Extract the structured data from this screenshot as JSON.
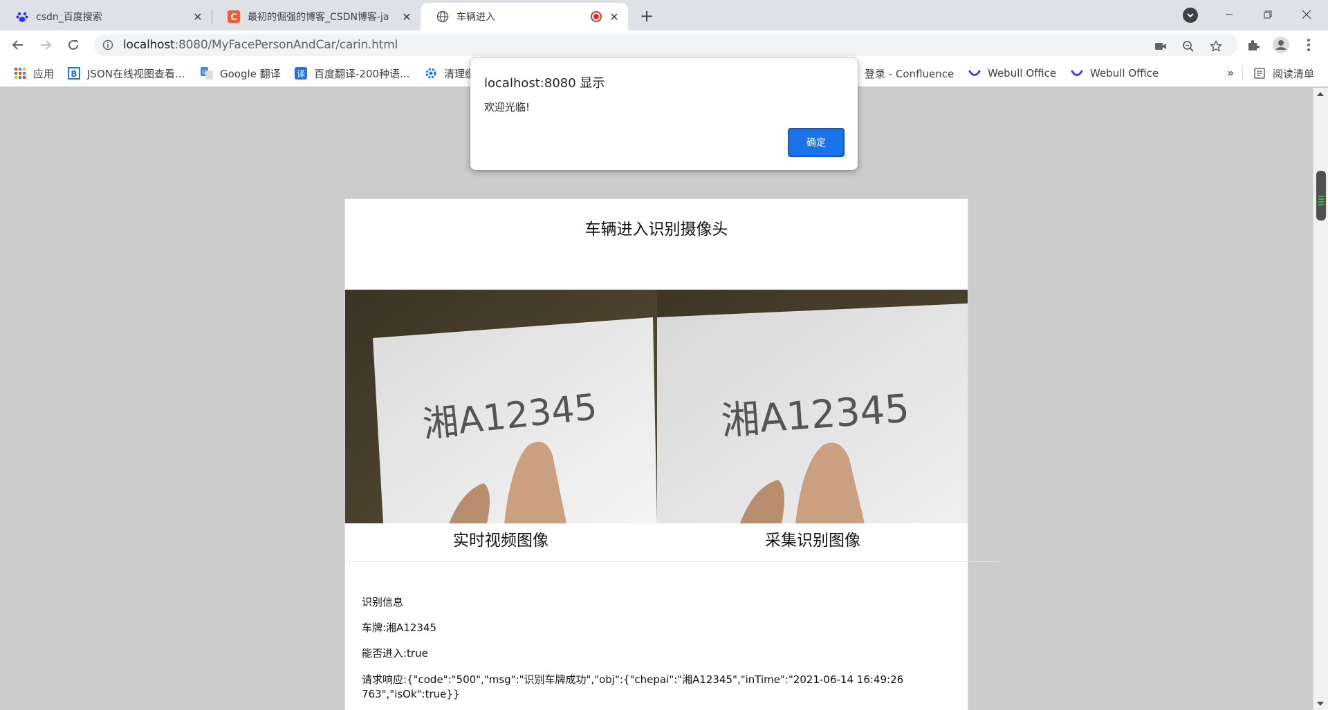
{
  "browser": {
    "tabs": [
      {
        "title": "csdn_百度搜索",
        "icon": "baidu-paw-icon"
      },
      {
        "title": "最初的倔强的博客_CSDN博客-ja",
        "icon": "csdn-icon"
      },
      {
        "title": "车辆进入",
        "icon": "globe-icon",
        "recording": true
      }
    ],
    "new_tab_label": "+",
    "url_host": "localhost",
    "url_path": ":8080/MyFacePersonAndCar/carin.html",
    "bookmarks": [
      {
        "label": "应用",
        "icon": "apps-grid-icon"
      },
      {
        "label": "JSON在线视图查看...",
        "icon": "b-icon"
      },
      {
        "label": "Google 翻译",
        "icon": "google-translate-icon"
      },
      {
        "label": "百度翻译-200种语...",
        "icon": "baidu-translate-icon"
      },
      {
        "label": "清理缓",
        "icon": "gear-icon"
      },
      {
        "label": "登录 - Confluence",
        "icon": "confluence-icon"
      },
      {
        "label": "Webull Office",
        "icon": "webull-icon"
      },
      {
        "label": "Webull Office",
        "icon": "webull-icon"
      }
    ],
    "bookmarks_more": "»",
    "reading_list": "阅读清单",
    "colors": {
      "accent": "#1a73e8",
      "tabstrip": "#dee1e6",
      "page_bg": "#cccccc",
      "record_red": "#d93025"
    }
  },
  "dialog": {
    "title": "localhost:8080 显示",
    "message": "欢迎光临!",
    "ok_label": "确定"
  },
  "page": {
    "heading": "车辆进入识别摄像头",
    "live_label": "实时视频图像",
    "capture_label": "采集识别图像",
    "photo_text": "湘A12345",
    "info_title": "识别信息",
    "plate_line": "车牌:湘A12345",
    "enter_line": "能否进入:true",
    "response_line1": "请求响应:{\"code\":\"500\",\"msg\":\"识别车牌成功\",\"obj\":{\"chepai\":\"湘A12345\",\"inTime\":\"2021-06-14 16:49:26",
    "response_line2": "763\",\"isOk\":true}}"
  }
}
